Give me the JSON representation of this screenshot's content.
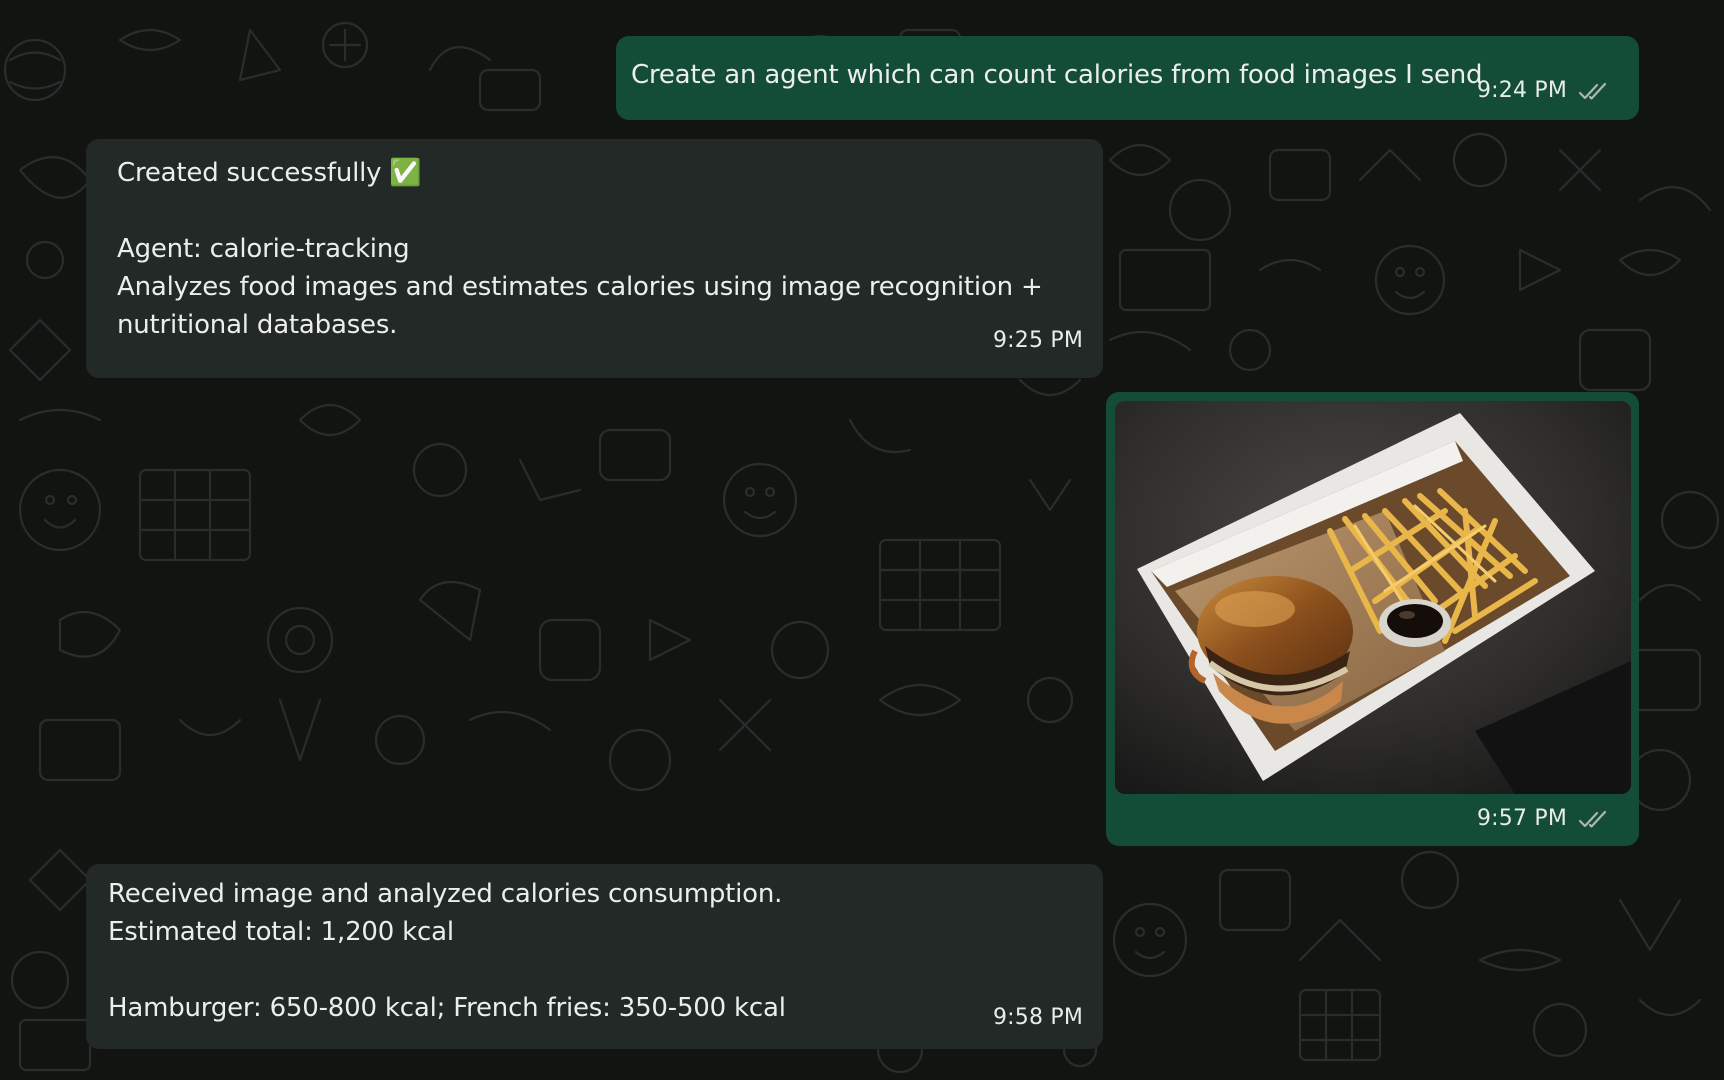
{
  "messages": [
    {
      "direction": "outgoing",
      "text": "Create an agent which can count calories from food images I send",
      "time": "9:24 PM",
      "status_icon": "double-check-read-icon"
    },
    {
      "direction": "incoming",
      "text": "Created successfully ✅\n\nAgent: calorie-tracking\nAnalyzes food images and estimates calories using image recognition +\nnutritional databases.",
      "time": "9:25 PM"
    },
    {
      "direction": "outgoing",
      "attachment": "photo of a hamburger and french fries in a takeout box",
      "time": "9:57 PM",
      "status_icon": "double-check-read-icon"
    },
    {
      "direction": "incoming",
      "text": "Received image and analyzed calories consumption.\nEstimated total: 1,200 kcal\n\nHamburger: 650-800 kcal; French fries: 350-500 kcal",
      "time": "9:58 PM"
    }
  ],
  "colors": {
    "background": "#121412",
    "outgoing_bubble": "#144d37",
    "incoming_bubble": "#222926",
    "text": "#eceeee",
    "tick_icon": "#a9b8b1"
  }
}
